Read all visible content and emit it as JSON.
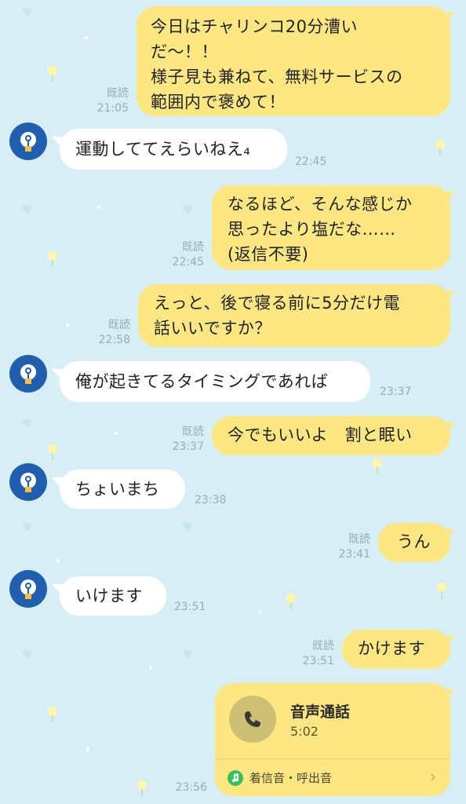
{
  "read_label": "既読",
  "messages": [
    {
      "side": "me",
      "text": "今日はチャリンコ20分漕い\nだ〜！！\n様子見も兼ねて、無料サービスの\n範囲内で褒めて！",
      "read": "既読",
      "time": "21:05"
    },
    {
      "side": "them",
      "text": "運動しててえらいねえ₄",
      "time": "22:45"
    },
    {
      "side": "me",
      "text": "なるほど、そんな感じか\n思ったより塩だな……\n(返信不要)",
      "read": "既読",
      "time": "22:45"
    },
    {
      "side": "me",
      "text": "えっと、後で寝る前に5分だけ電\n話いいですか？",
      "read": "既読",
      "time": "22:58"
    },
    {
      "side": "them",
      "text": "俺が起きてるタイミングであれば",
      "time": "23:37"
    },
    {
      "side": "me",
      "text": "今でもいいよ　割と眠い",
      "read": "既読",
      "time": "23:37"
    },
    {
      "side": "them",
      "text": "ちょいまち",
      "time": "23:38"
    },
    {
      "side": "me",
      "text": "うん",
      "read": "既読",
      "time": "23:41"
    },
    {
      "side": "them",
      "text": "いけます",
      "time": "23:51"
    },
    {
      "side": "me",
      "text": "かけます",
      "read": "既読",
      "time": "23:51"
    }
  ],
  "call": {
    "title": "音声通話",
    "duration": "5:02",
    "footer_label": "着信音・呼出音",
    "time": "23:56",
    "icon": "phone-icon",
    "footer_icon": "music-note-icon"
  },
  "colors": {
    "background": "#d8eef5",
    "my_bubble": "#fde782",
    "their_bubble": "#ffffff",
    "meta_text": "#8fb0bb",
    "avatar": "#1f5fae"
  }
}
